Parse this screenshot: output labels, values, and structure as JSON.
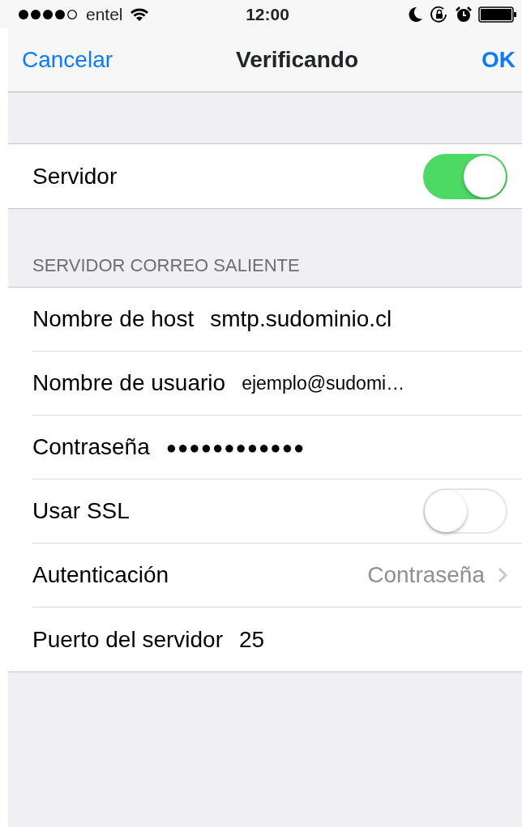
{
  "status_bar": {
    "carrier": "entel",
    "time": "12:00"
  },
  "nav_bar": {
    "left_button": "Cancelar",
    "title": "Verificando",
    "right_button": "OK"
  },
  "sections": [
    {
      "rows": [
        {
          "kind": "toggle",
          "label": "Servidor",
          "on": true
        }
      ]
    },
    {
      "header": "SERVIDOR CORREO SALIENTE",
      "rows": [
        {
          "kind": "field",
          "label": "Nombre de host",
          "value": "smtp.sudominio.cl"
        },
        {
          "kind": "field_small",
          "label": "Nombre de usuario",
          "value": "ejemplo@sudomi…"
        },
        {
          "kind": "password",
          "label": "Contraseña",
          "value": "●●●●●●●●●●●●"
        },
        {
          "kind": "toggle",
          "label": "Usar SSL",
          "on": false
        },
        {
          "kind": "disclosure",
          "label": "Autenticación",
          "value": "Contraseña"
        },
        {
          "kind": "field",
          "label": "Puerto del servidor",
          "value": "25"
        }
      ]
    }
  ]
}
